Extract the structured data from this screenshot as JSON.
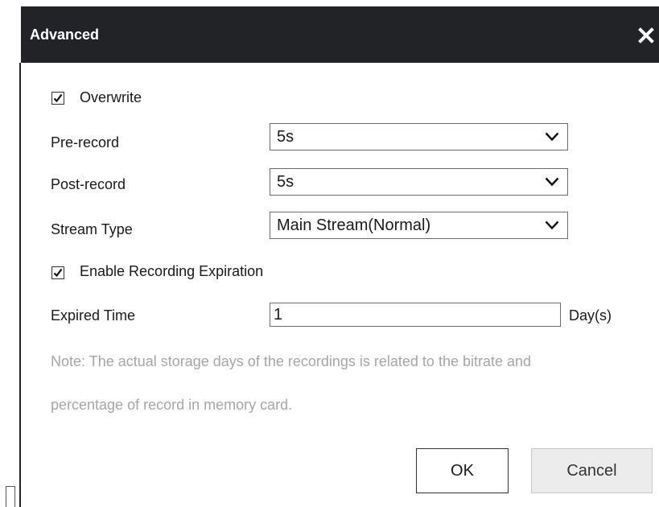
{
  "dialog": {
    "title": "Advanced",
    "close_icon": "close-icon"
  },
  "overwrite": {
    "label": "Overwrite",
    "checked": true
  },
  "pre_record": {
    "label": "Pre-record",
    "value": "5s"
  },
  "post_record": {
    "label": "Post-record",
    "value": "5s"
  },
  "stream_type": {
    "label": "Stream Type",
    "value": "Main Stream(Normal)"
  },
  "enable_expiration": {
    "label": "Enable Recording Expiration",
    "checked": true
  },
  "expired_time": {
    "label": "Expired Time",
    "value": "1",
    "unit": "Day(s)"
  },
  "note": {
    "line1": "Note: The actual storage days of the recordings is related to the bitrate and",
    "line2": "percentage of record in memory card."
  },
  "buttons": {
    "ok": "OK",
    "cancel": "Cancel"
  },
  "colors": {
    "titlebar": "#222326",
    "note_text": "#a6a6a6",
    "cancel_bg": "#ececec"
  }
}
